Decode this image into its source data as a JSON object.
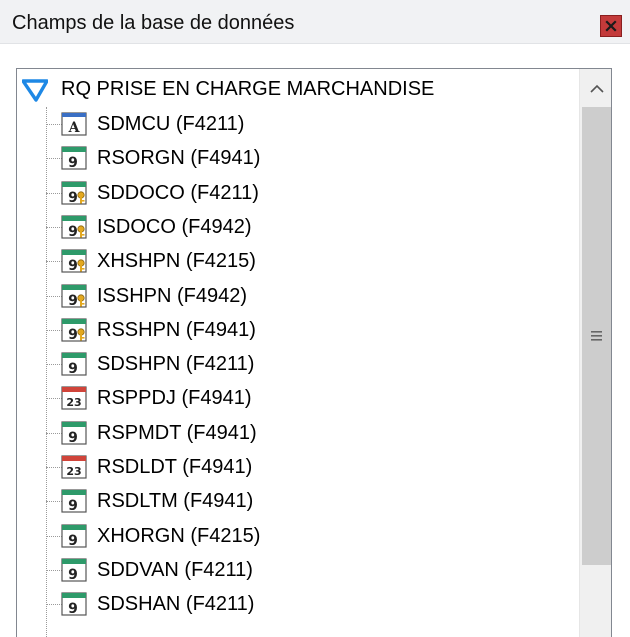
{
  "panel": {
    "title": "Champs de la base de données",
    "close_icon": "close-icon"
  },
  "tree": {
    "root": {
      "label": "RQ PRISE EN CHARGE MARCHANDISE",
      "icon": "query-funnel-icon"
    },
    "items": [
      {
        "label": "SDMCU (F4211)",
        "icon": "text-field-icon"
      },
      {
        "label": "RSORGN (F4941)",
        "icon": "numeric-field-icon"
      },
      {
        "label": "SDDOCO (F4211)",
        "icon": "numeric-key-field-icon"
      },
      {
        "label": "ISDOCO (F4942)",
        "icon": "numeric-key-field-icon"
      },
      {
        "label": "XHSHPN (F4215)",
        "icon": "numeric-key-field-icon"
      },
      {
        "label": "ISSHPN (F4942)",
        "icon": "numeric-key-field-icon"
      },
      {
        "label": "RSSHPN (F4941)",
        "icon": "numeric-key-field-icon"
      },
      {
        "label": "SDSHPN (F4211)",
        "icon": "numeric-field-icon"
      },
      {
        "label": "RSPPDJ (F4941)",
        "icon": "date-field-icon"
      },
      {
        "label": "RSPMDT (F4941)",
        "icon": "numeric-field-icon"
      },
      {
        "label": "RSDLDT (F4941)",
        "icon": "date-field-icon"
      },
      {
        "label": "RSDLTM (F4941)",
        "icon": "numeric-field-icon"
      },
      {
        "label": "XHORGN (F4215)",
        "icon": "numeric-field-icon"
      },
      {
        "label": "SDDVAN (F4211)",
        "icon": "numeric-field-icon"
      },
      {
        "label": "SDSHAN (F4211)",
        "icon": "numeric-field-icon"
      }
    ]
  },
  "icon_glyphs": {
    "text": "A",
    "numeric": "9",
    "date": "23"
  },
  "colors": {
    "numeric_accent": "#2e9a6a",
    "date_accent": "#d0443a",
    "text_accent": "#3a6fc4",
    "key_accent": "#e3a81f",
    "root_icon": "#1e88e5"
  }
}
